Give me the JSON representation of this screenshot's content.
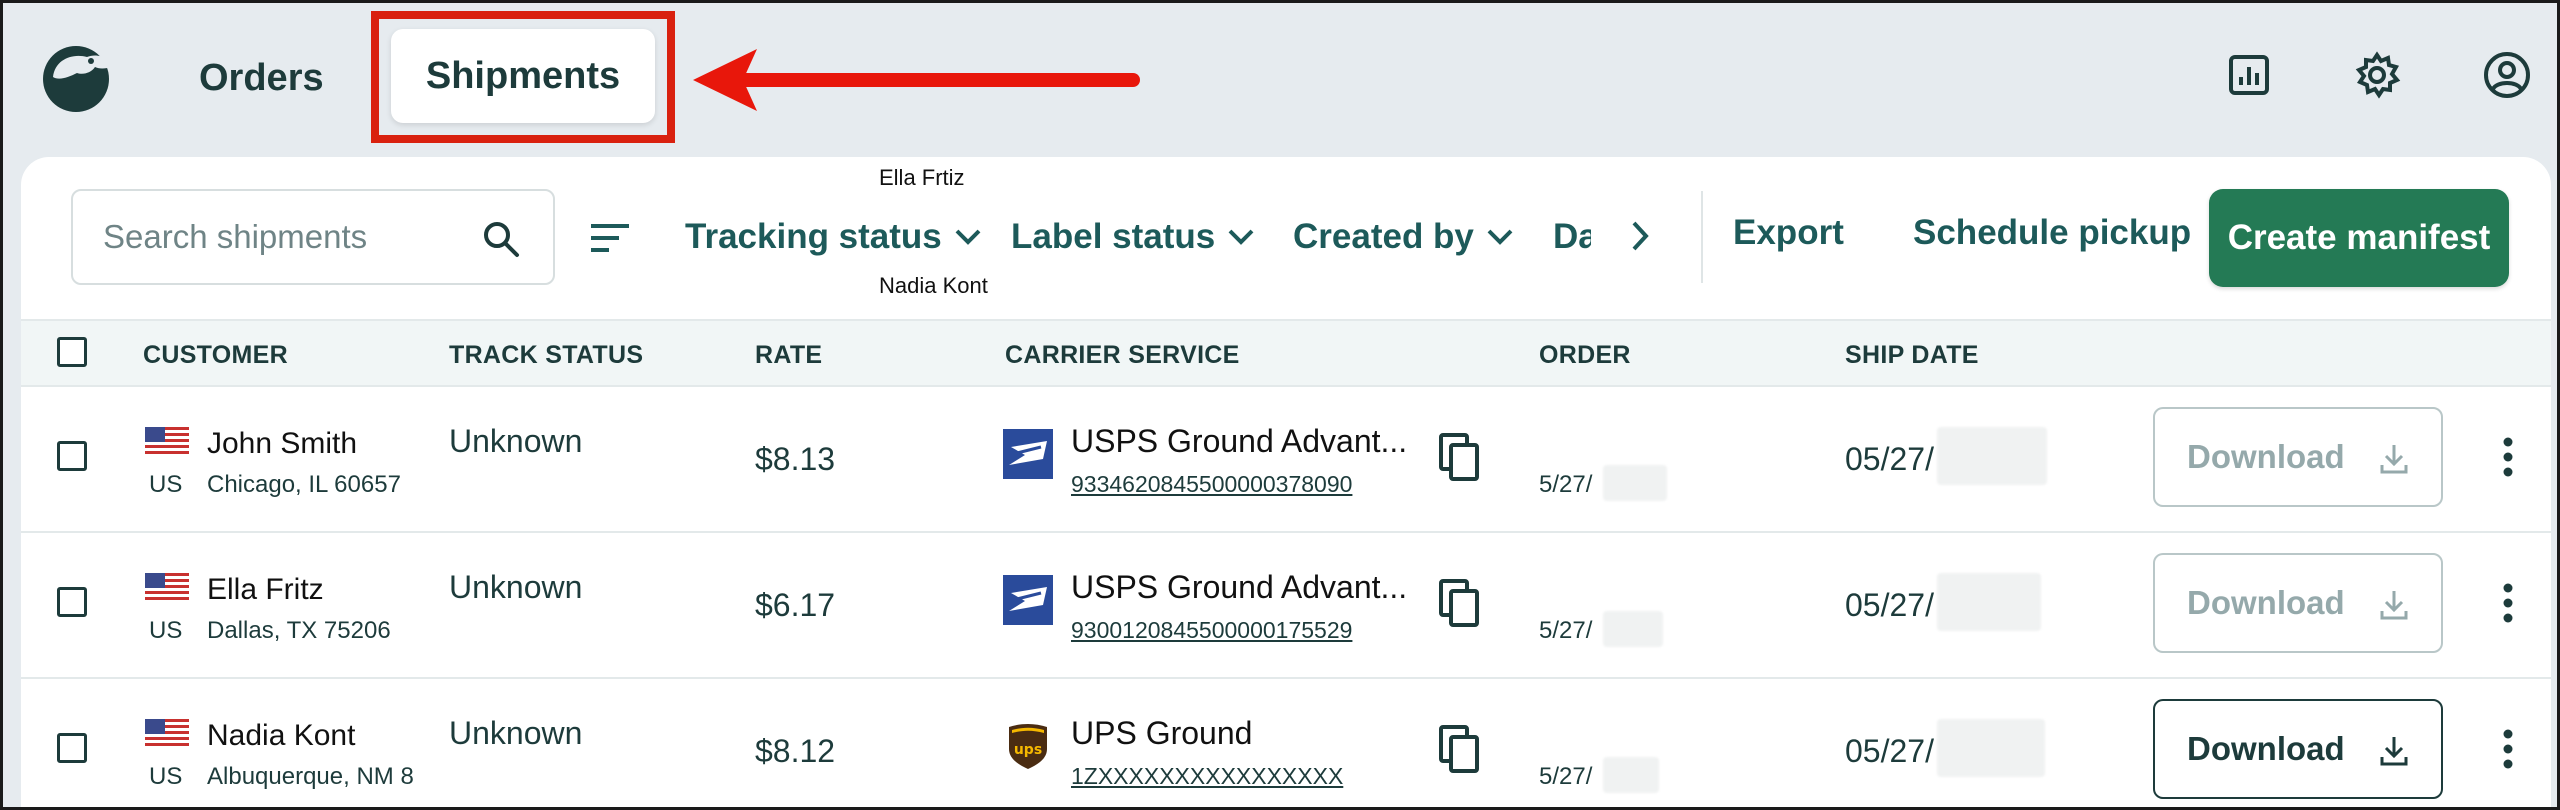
{
  "nav": {
    "orders_label": "Orders",
    "shipments_label": "Shipments"
  },
  "toolbar": {
    "search_placeholder": "Search shipments",
    "filters": {
      "tracking_status": "Tracking status",
      "label_status": "Label status",
      "created_by": "Created by",
      "date_partial": "Da"
    },
    "tooltip_top": "Ella Frtiz",
    "tooltip_bottom": "Nadia Kont",
    "export_label": "Export",
    "schedule_pickup_label": "Schedule pickup",
    "create_manifest_label": "Create manifest"
  },
  "table": {
    "headers": {
      "customer": "CUSTOMER",
      "track_status": "TRACK STATUS",
      "rate": "RATE",
      "carrier_service": "CARRIER SERVICE",
      "order": "ORDER",
      "ship_date": "SHIP DATE"
    },
    "rows": [
      {
        "country": "US",
        "name": "John Smith",
        "address": "Chicago, IL 60657",
        "track_status": "Unknown",
        "rate": "$8.13",
        "carrier": "usps",
        "service": "USPS Ground Advant...",
        "tracking_number": "9334620845500000378090",
        "order": "5/27/",
        "ship_date": "05/27/",
        "download_label": "Download",
        "download_enabled": false
      },
      {
        "country": "US",
        "name": "Ella Fritz",
        "address": "Dallas, TX 75206",
        "track_status": "Unknown",
        "rate": "$6.17",
        "carrier": "usps",
        "service": "USPS Ground Advant...",
        "tracking_number": "9300120845500000175529",
        "order": "5/27/",
        "ship_date": "05/27/",
        "download_label": "Download",
        "download_enabled": false
      },
      {
        "country": "US",
        "name": "Nadia Kont",
        "address": "Albuquerque, NM 8",
        "track_status": "Unknown",
        "rate": "$8.12",
        "carrier": "ups",
        "service": "UPS Ground",
        "tracking_number": "1ZXXXXXXXXXXXXXXXX",
        "order": "5/27/",
        "ship_date": "05/27/",
        "download_label": "Download",
        "download_enabled": true
      }
    ]
  },
  "colors": {
    "accent_green": "#247a55",
    "highlight_red": "#d9210f",
    "text_teal": "#1d5a5a",
    "disabled": "#95a9ab"
  },
  "icons": [
    "app-logo-icon",
    "report-icon",
    "gear-icon",
    "user-icon",
    "search-icon",
    "sort-icon",
    "chevron-down-icon",
    "chevron-right-icon",
    "us-flag-icon",
    "usps-logo-icon",
    "ups-logo-icon",
    "copy-icon",
    "download-icon",
    "kebab-icon"
  ]
}
